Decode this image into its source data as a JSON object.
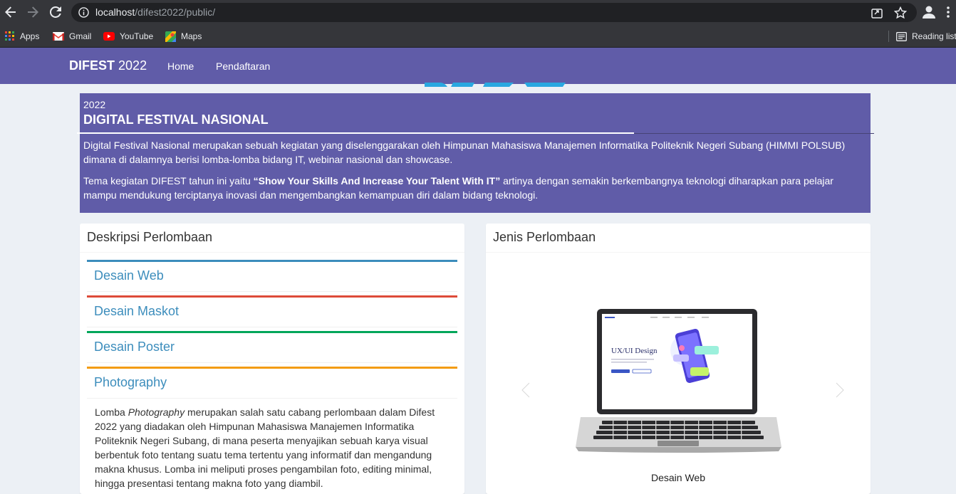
{
  "browser": {
    "url_host": "localhost",
    "url_path": "/difest2022/public/",
    "bookmarks": [
      {
        "label": "Apps",
        "icon": "apps-grid-icon"
      },
      {
        "label": "Gmail",
        "icon": "gmail-icon"
      },
      {
        "label": "YouTube",
        "icon": "youtube-icon"
      },
      {
        "label": "Maps",
        "icon": "maps-icon"
      }
    ],
    "reading_list": "Reading list"
  },
  "navbar": {
    "brand_bold": "DIFEST",
    "brand_rest": "2022",
    "links": [
      "Home",
      "Pendaftaran"
    ]
  },
  "hero": {
    "year": "2022",
    "title": "DIGITAL FESTIVAL NASIONAL",
    "paragraph1": "Digital Festival Nasional merupakan sebuah kegiatan yang diselenggarakan oleh Himpunan Mahasiswa Manajemen Informatika Politeknik Negeri Subang (HIMMI POLSUB) dimana di dalamnya berisi lomba-lomba bidang IT, webinar nasional dan showcase.",
    "paragraph2_before": "Tema kegiatan DIFEST tahun ini yaitu ",
    "paragraph2_theme": "“Show Your Skills And Increase Your Talent With IT”",
    "paragraph2_after": " artinya dengan semakin berkembangnya teknologi diharapkan para pelajar mampu mendukung terciptanya inovasi dan mengembangkan kemampuan diri dalam bidang teknologi."
  },
  "left_box": {
    "title": "Deskripsi Perlombaan",
    "items": [
      {
        "label": "Desain Web",
        "color": "#3c8dbc"
      },
      {
        "label": "Desain Maskot",
        "color": "#dd4b39"
      },
      {
        "label": "Desain Poster",
        "color": "#00a65a"
      },
      {
        "label": "Photography",
        "color": "#f39c12"
      }
    ],
    "body_before": "Lomba ",
    "body_italic": "Photography",
    "body_after": " merupakan salah satu cabang perlombaan dalam Difest 2022 yang diadakan oleh Himpunan Mahasiswa Manajemen Informatika Politeknik Negeri Subang, di mana peserta menyajikan sebuah karya visual berbentuk foto tentang suatu tema tertentu yang informatif dan mengandung makna khusus. Lomba ini meliputi proses pengambilan foto, editing minimal, hingga presentasi tentang makna foto yang diambil."
  },
  "right_box": {
    "title": "Jenis Perlombaan",
    "slide_screen_text": "UX/UI Design",
    "caption": "Desain Web"
  }
}
